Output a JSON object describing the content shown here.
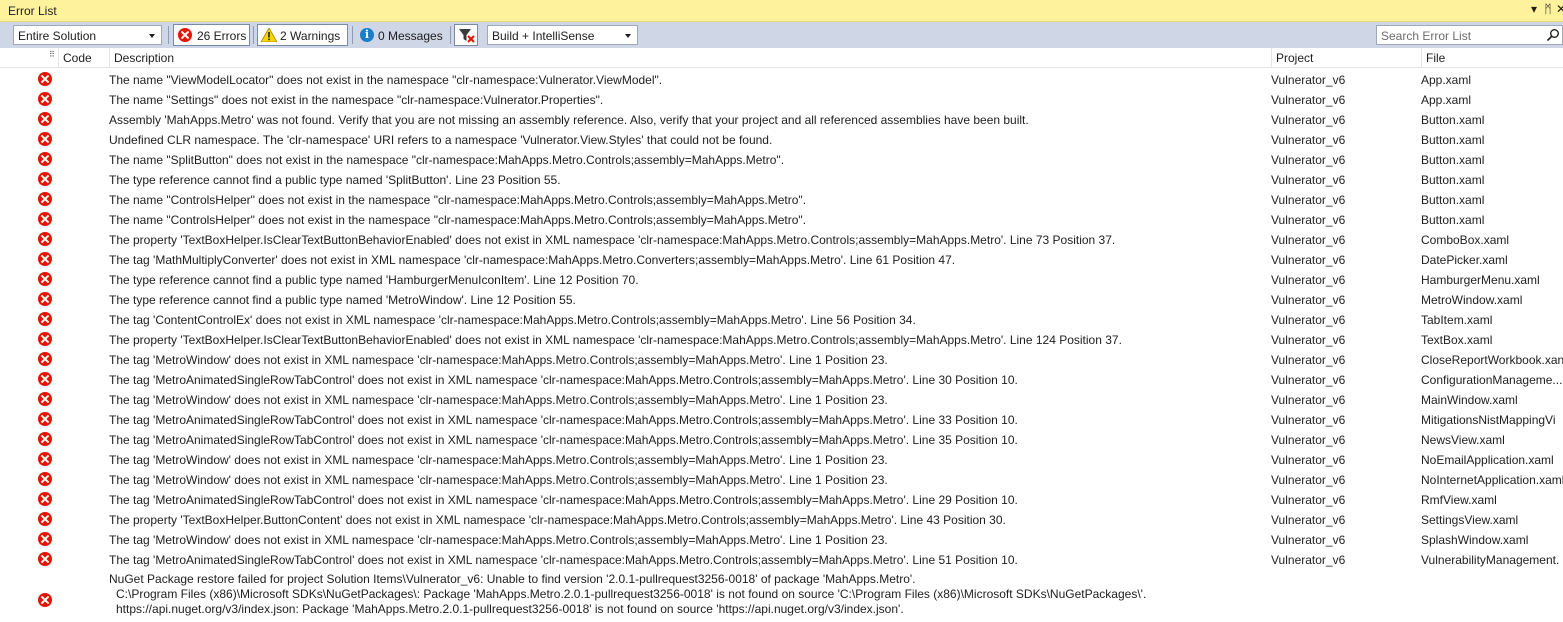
{
  "window": {
    "title": "Error List",
    "controls": [
      "▾",
      "ᛗ",
      "✕"
    ]
  },
  "toolbar": {
    "scope_value": "Entire Solution",
    "errors_label": "26 Errors",
    "warnings_label": "2 Warnings",
    "messages_label": "0 Messages",
    "build_filter_value": "Build + IntelliSense",
    "search_placeholder": "Search Error List"
  },
  "columns": {
    "code": "Code",
    "description": "Description",
    "project": "Project",
    "file": "File"
  },
  "rows": [
    {
      "description": "The name \"ViewModelLocator\" does not exist in the namespace \"clr-namespace:Vulnerator.ViewModel\".",
      "project": "Vulnerator_v6",
      "file": "App.xaml"
    },
    {
      "description": "The name \"Settings\" does not exist in the namespace \"clr-namespace:Vulnerator.Properties\".",
      "project": "Vulnerator_v6",
      "file": "App.xaml"
    },
    {
      "description": "Assembly 'MahApps.Metro' was not found. Verify that you are not missing an assembly reference. Also, verify that your project and all referenced assemblies have been built.",
      "project": "Vulnerator_v6",
      "file": "Button.xaml"
    },
    {
      "description": "Undefined CLR namespace. The 'clr-namespace' URI refers to a namespace 'Vulnerator.View.Styles' that could not be found.",
      "project": "Vulnerator_v6",
      "file": "Button.xaml"
    },
    {
      "description": "The name \"SplitButton\" does not exist in the namespace \"clr-namespace:MahApps.Metro.Controls;assembly=MahApps.Metro\".",
      "project": "Vulnerator_v6",
      "file": "Button.xaml"
    },
    {
      "description": "The type reference cannot find a public type named 'SplitButton'. Line 23 Position 55.",
      "project": "Vulnerator_v6",
      "file": "Button.xaml"
    },
    {
      "description": "The name \"ControlsHelper\" does not exist in the namespace \"clr-namespace:MahApps.Metro.Controls;assembly=MahApps.Metro\".",
      "project": "Vulnerator_v6",
      "file": "Button.xaml"
    },
    {
      "description": "The name \"ControlsHelper\" does not exist in the namespace \"clr-namespace:MahApps.Metro.Controls;assembly=MahApps.Metro\".",
      "project": "Vulnerator_v6",
      "file": "Button.xaml"
    },
    {
      "description": "The property 'TextBoxHelper.IsClearTextButtonBehaviorEnabled' does not exist in XML namespace 'clr-namespace:MahApps.Metro.Controls;assembly=MahApps.Metro'. Line 73 Position 37.",
      "project": "Vulnerator_v6",
      "file": "ComboBox.xaml"
    },
    {
      "description": "The tag 'MathMultiplyConverter' does not exist in XML namespace 'clr-namespace:MahApps.Metro.Converters;assembly=MahApps.Metro'. Line 61 Position 47.",
      "project": "Vulnerator_v6",
      "file": "DatePicker.xaml"
    },
    {
      "description": "The type reference cannot find a public type named 'HamburgerMenuIconItem'. Line 12 Position 70.",
      "project": "Vulnerator_v6",
      "file": "HamburgerMenu.xaml"
    },
    {
      "description": "The type reference cannot find a public type named 'MetroWindow'. Line 12 Position 55.",
      "project": "Vulnerator_v6",
      "file": "MetroWindow.xaml"
    },
    {
      "description": "The tag 'ContentControlEx' does not exist in XML namespace 'clr-namespace:MahApps.Metro.Controls;assembly=MahApps.Metro'. Line 56 Position 34.",
      "project": "Vulnerator_v6",
      "file": "TabItem.xaml"
    },
    {
      "description": "The property 'TextBoxHelper.IsClearTextButtonBehaviorEnabled' does not exist in XML namespace 'clr-namespace:MahApps.Metro.Controls;assembly=MahApps.Metro'. Line 124 Position 37.",
      "project": "Vulnerator_v6",
      "file": "TextBox.xaml"
    },
    {
      "description": "The tag 'MetroWindow' does not exist in XML namespace 'clr-namespace:MahApps.Metro.Controls;assembly=MahApps.Metro'. Line 1 Position 23.",
      "project": "Vulnerator_v6",
      "file": "CloseReportWorkbook.xan"
    },
    {
      "description": "The tag 'MetroAnimatedSingleRowTabControl' does not exist in XML namespace 'clr-namespace:MahApps.Metro.Controls;assembly=MahApps.Metro'. Line 30 Position 10.",
      "project": "Vulnerator_v6",
      "file": "ConfigurationManageme..."
    },
    {
      "description": "The tag 'MetroWindow' does not exist in XML namespace 'clr-namespace:MahApps.Metro.Controls;assembly=MahApps.Metro'. Line 1 Position 23.",
      "project": "Vulnerator_v6",
      "file": "MainWindow.xaml"
    },
    {
      "description": "The tag 'MetroAnimatedSingleRowTabControl' does not exist in XML namespace 'clr-namespace:MahApps.Metro.Controls;assembly=MahApps.Metro'. Line 33 Position 10.",
      "project": "Vulnerator_v6",
      "file": "MitigationsNistMappingVi"
    },
    {
      "description": "The tag 'MetroAnimatedSingleRowTabControl' does not exist in XML namespace 'clr-namespace:MahApps.Metro.Controls;assembly=MahApps.Metro'. Line 35 Position 10.",
      "project": "Vulnerator_v6",
      "file": "NewsView.xaml"
    },
    {
      "description": "The tag 'MetroWindow' does not exist in XML namespace 'clr-namespace:MahApps.Metro.Controls;assembly=MahApps.Metro'. Line 1 Position 23.",
      "project": "Vulnerator_v6",
      "file": "NoEmailApplication.xaml"
    },
    {
      "description": "The tag 'MetroWindow' does not exist in XML namespace 'clr-namespace:MahApps.Metro.Controls;assembly=MahApps.Metro'. Line 1 Position 23.",
      "project": "Vulnerator_v6",
      "file": "NoInternetApplication.xaml"
    },
    {
      "description": "The tag 'MetroAnimatedSingleRowTabControl' does not exist in XML namespace 'clr-namespace:MahApps.Metro.Controls;assembly=MahApps.Metro'. Line 29 Position 10.",
      "project": "Vulnerator_v6",
      "file": "RmfView.xaml"
    },
    {
      "description": "The property 'TextBoxHelper.ButtonContent' does not exist in XML namespace 'clr-namespace:MahApps.Metro.Controls;assembly=MahApps.Metro'. Line 43 Position 30.",
      "project": "Vulnerator_v6",
      "file": "SettingsView.xaml"
    },
    {
      "description": "The tag 'MetroWindow' does not exist in XML namespace 'clr-namespace:MahApps.Metro.Controls;assembly=MahApps.Metro'. Line 1 Position 23.",
      "project": "Vulnerator_v6",
      "file": "SplashWindow.xaml"
    },
    {
      "description": "The tag 'MetroAnimatedSingleRowTabControl' does not exist in XML namespace 'clr-namespace:MahApps.Metro.Controls;assembly=MahApps.Metro'. Line 51 Position 10.",
      "project": "Vulnerator_v6",
      "file": "VulnerabilityManagement."
    }
  ],
  "nuget_error": {
    "lines": [
      "NuGet Package restore failed for project Solution Items\\Vulnerator_v6: Unable to find version '2.0.1-pullrequest3256-0018' of package 'MahApps.Metro'.",
      "C:\\Program Files (x86)\\Microsoft SDKs\\NuGetPackages\\: Package 'MahApps.Metro.2.0.1-pullrequest3256-0018' is not found on source 'C:\\Program Files (x86)\\Microsoft SDKs\\NuGetPackages\\'.",
      "https://api.nuget.org/v3/index.json: Package 'MahApps.Metro.2.0.1-pullrequest3256-0018' is not found on source 'https://api.nuget.org/v3/index.json'."
    ]
  },
  "colors": {
    "title_bar": "#fff29d",
    "toolbar": "#cfd6e5",
    "error_red": "#e51400",
    "info_blue": "#1c7ec6",
    "warning_yellow": "#f7d500"
  }
}
